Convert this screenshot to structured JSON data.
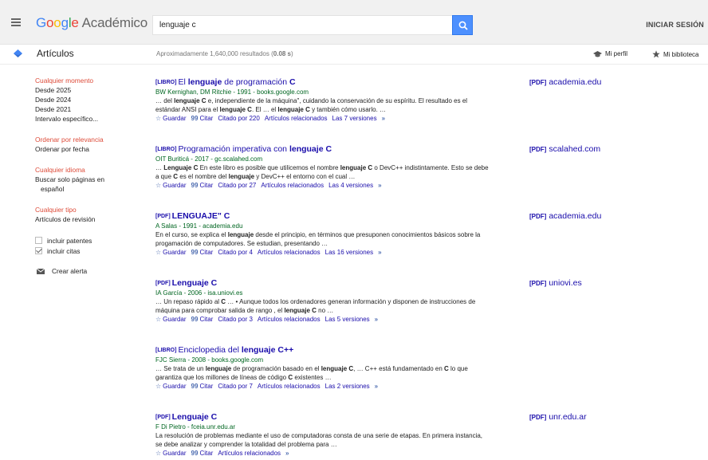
{
  "header": {
    "logo_google": "Google",
    "logo_product": "Académico",
    "search_value": "lenguaje c",
    "signin_label": "INICIAR SESIÓN"
  },
  "subbar": {
    "section_title": "Artículos",
    "result_count_prefix": "Aproximadamente 1,640,000 resultados (",
    "result_time": "0.08 s",
    "result_count_suffix": ")",
    "profile_label": "Mi perfil",
    "library_label": "Mi biblioteca"
  },
  "sidebar": {
    "time": [
      "Cualquier momento",
      "Desde 2025",
      "Desde 2024",
      "Desde 2021",
      "Intervalo específico..."
    ],
    "sort": [
      "Ordenar por relevancia",
      "Ordenar por fecha"
    ],
    "language": [
      "Cualquier idioma",
      "Buscar solo páginas en",
      "español"
    ],
    "type": [
      "Cualquier tipo",
      "Artículos de revisión"
    ],
    "include_patents": "incluir patentes",
    "include_citations": "incluir citas",
    "create_alert": "Crear alerta"
  },
  "icons": {
    "accent": "#4285f4",
    "link": "#1a0dab",
    "green": "#006621",
    "active": "#dd4b39"
  },
  "results": [
    {
      "tag": "[LIBRO]",
      "title_a": "El ",
      "title_b": "lenguaje",
      "title_c": " de programación ",
      "title_d": "C",
      "authors": "BW Kernighan, DM Ritchie - 1991 - books.google.com",
      "snippet": "… del <b>lenguaje C</b> e, independiente de la máquina\", cuidando la conservación de su espíritu. El resultado es el estándar ANSI para el <b>lenguaje C</b>. El … el <b>lenguaje C</b> y también cómo usarlo. …",
      "cited": "Citado por 220",
      "versions": "Las 7 versiones",
      "pdf": "academia.edu"
    },
    {
      "tag": "[LIBRO]",
      "title_a": "Programación imperativa con ",
      "title_b": "lenguaje C",
      "title_c": "",
      "title_d": "",
      "authors": "OIT Buriticá - 2017 - gc.scalahed.com",
      "snippet": "… <b>Lenguaje C</b> En este libro es posible que utilicemos el nombre <b>lenguaje C</b> o DevC++ indistintamente. Esto se debe a que <b>C</b> es el nombre del <b>lenguaje</b> y DevC++ el entorno con el cual …",
      "cited": "Citado por 27",
      "versions": "Las 4 versiones",
      "pdf": "scalahed.com"
    },
    {
      "tag": "[PDF]",
      "title_a": "",
      "title_b": "LENGUAJE\" C",
      "title_c": "",
      "title_d": "",
      "authors": "A Salas - 1991 - academia.edu",
      "snippet": "En el curso, se explica el <b>lenguaje</b> desde el principio, en términos que presuponen conocimientos básicos sobre la progamación de computadores. Se estudian, presentando …",
      "cited": "Citado por 4",
      "versions": "Las 16 versiones",
      "pdf": "academia.edu"
    },
    {
      "tag": "[PDF]",
      "title_a": "",
      "title_b": "Lenguaje C",
      "title_c": "",
      "title_d": "",
      "authors": "IA García - 2006 - isa.uniovi.es",
      "snippet": "… Un repaso rápido al <b>C</b> … • Aunque todos los ordenadores generan información y disponen de instrucciones de máquina para comprobar salida de rango , el <b>lenguaje C</b> no …",
      "cited": "Citado por 3",
      "versions": "Las 5 versiones",
      "pdf": "uniovi.es"
    },
    {
      "tag": "[LIBRO]",
      "title_a": "Enciclopedia del ",
      "title_b": "lenguaje C++",
      "title_c": "",
      "title_d": "",
      "authors": "FJC Sierra - 2008 - books.google.com",
      "snippet": "… Se trata de un <b>lenguaje</b> de programación basado en el <b>lenguaje C</b>, … C++ está fundamentado en <b>C</b> lo que garantiza que los millones de líneas de código <b>C</b> existentes …",
      "cited": "Citado por 7",
      "versions": "Las 2 versiones",
      "pdf": ""
    },
    {
      "tag": "[PDF]",
      "title_a": "",
      "title_b": "Lenguaje C",
      "title_c": "",
      "title_d": "",
      "authors": "F Di Pietro - fceia.unr.edu.ar",
      "snippet": "La resolución de problemas mediante el uso de computadoras consta de una serie de etapas. En primera instancia, se debe analizar y comprender la totalidad del problema para …",
      "cited": "",
      "versions": "",
      "pdf": "unr.edu.ar"
    }
  ],
  "actions": {
    "save": "Guardar",
    "cite": "Citar",
    "related": "Artículos relacionados",
    "pdf_tag": "[PDF]"
  }
}
